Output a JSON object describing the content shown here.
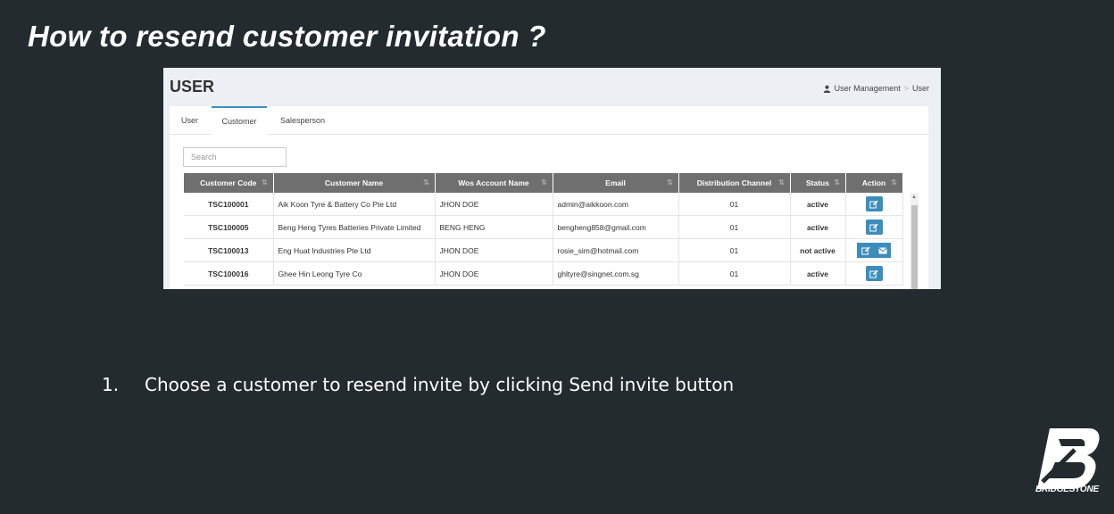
{
  "slide": {
    "title": "How to resend customer invitation ?",
    "step_number": "1.",
    "step_text": "Choose a customer to resend invite by clicking Send invite button",
    "logo_text": "BRIDGESTONE"
  },
  "app": {
    "page_title": "USER",
    "breadcrumb": [
      "User Management",
      "User"
    ],
    "tabs": [
      {
        "label": "User",
        "active": false
      },
      {
        "label": "Customer",
        "active": true
      },
      {
        "label": "Salesperson",
        "active": false
      }
    ],
    "search": {
      "placeholder": "Search",
      "value": ""
    },
    "table": {
      "columns": [
        "Customer Code",
        "Customer Name",
        "Wos Account Name",
        "Email",
        "Distribution Channel",
        "Status",
        "Action"
      ],
      "rows": [
        {
          "code": "TSC100001",
          "name": "Aik Koon Tyre & Battery Co Pte Ltd",
          "wos": "JHON DOE",
          "email": "admin@aikkoon.com",
          "channel": "01",
          "status": "active",
          "actions": [
            "edit-icon"
          ]
        },
        {
          "code": "TSC100005",
          "name": "Beng Heng Tyres Batteries Private Limited",
          "wos": "BENG HENG",
          "email": "bengheng858@gmail.com",
          "channel": "01",
          "status": "active",
          "actions": [
            "edit-icon"
          ]
        },
        {
          "code": "TSC100013",
          "name": "Eng Huat Industries Pte Ltd",
          "wos": "JHON DOE",
          "email": "rosie_sim@hotmail.com",
          "channel": "01",
          "status": "not active",
          "actions": [
            "edit-icon",
            "envelope-icon"
          ]
        },
        {
          "code": "TSC100016",
          "name": "Ghee Hin Leong Tyre Co",
          "wos": "JHON DOE",
          "email": "ghltyre@singnet.com.sg",
          "channel": "01",
          "status": "active",
          "actions": [
            "edit-icon"
          ]
        }
      ]
    }
  },
  "colors": {
    "slide_bg": "#232b2f",
    "header_bg": "#6f6f6f",
    "accent": "#3c8dbc",
    "status_active": "#00a65a",
    "status_inactive": "#dd4b39"
  }
}
